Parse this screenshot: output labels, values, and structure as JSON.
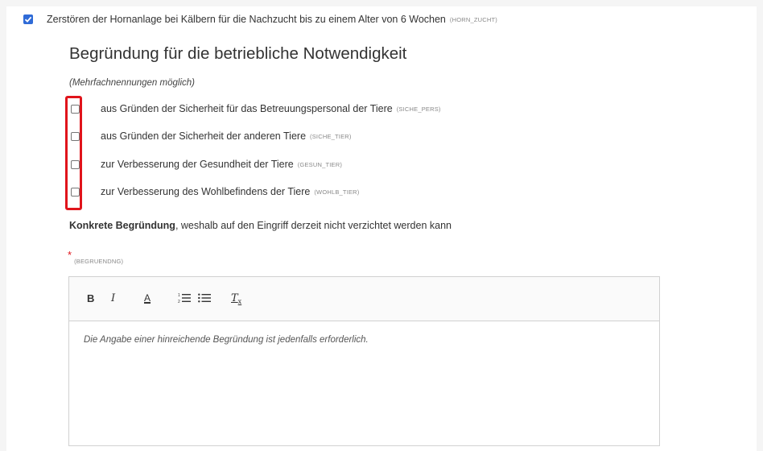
{
  "main_option": {
    "checked": true,
    "label": "Zerstören der Hornanlage bei Kälbern für die Nachzucht bis zu einem Alter von 6 Wochen",
    "code": "(HORN_ZUCHT)"
  },
  "section": {
    "title": "Begründung für die betriebliche Notwendigkeit",
    "hint": "(Mehrfachnennungen möglich)",
    "options": [
      {
        "label": "aus Gründen der Sicherheit für das Betreuungspersonal der Tiere",
        "code": "(SICHE_PERS)",
        "checked": false
      },
      {
        "label": "aus Gründen der Sicherheit der anderen Tiere",
        "code": "(SICHE_TIER)",
        "checked": false
      },
      {
        "label": "zur Verbesserung der Gesundheit der Tiere",
        "code": "(GESUN_TIER)",
        "checked": false
      },
      {
        "label": "zur Verbesserung des Wohlbefindens der Tiere",
        "code": "(WOHLB_TIER)",
        "checked": false
      }
    ]
  },
  "concrete": {
    "bold": "Konkrete Begründung",
    "rest": ", weshalb auf den Eingriff derzeit nicht verzichtet werden kann",
    "required_marker": "*",
    "code": "(BEGRUENDNG)"
  },
  "editor": {
    "toolbar": {
      "bold": "B",
      "italic": "I",
      "color": "A",
      "clear_format": "T"
    },
    "placeholder": "Die Angabe einer hinreichende Begründung ist jedenfalls erforderlich."
  },
  "colors": {
    "accent": "#2f6bd7",
    "highlight": "#e0141b",
    "required": "#e0141b"
  }
}
